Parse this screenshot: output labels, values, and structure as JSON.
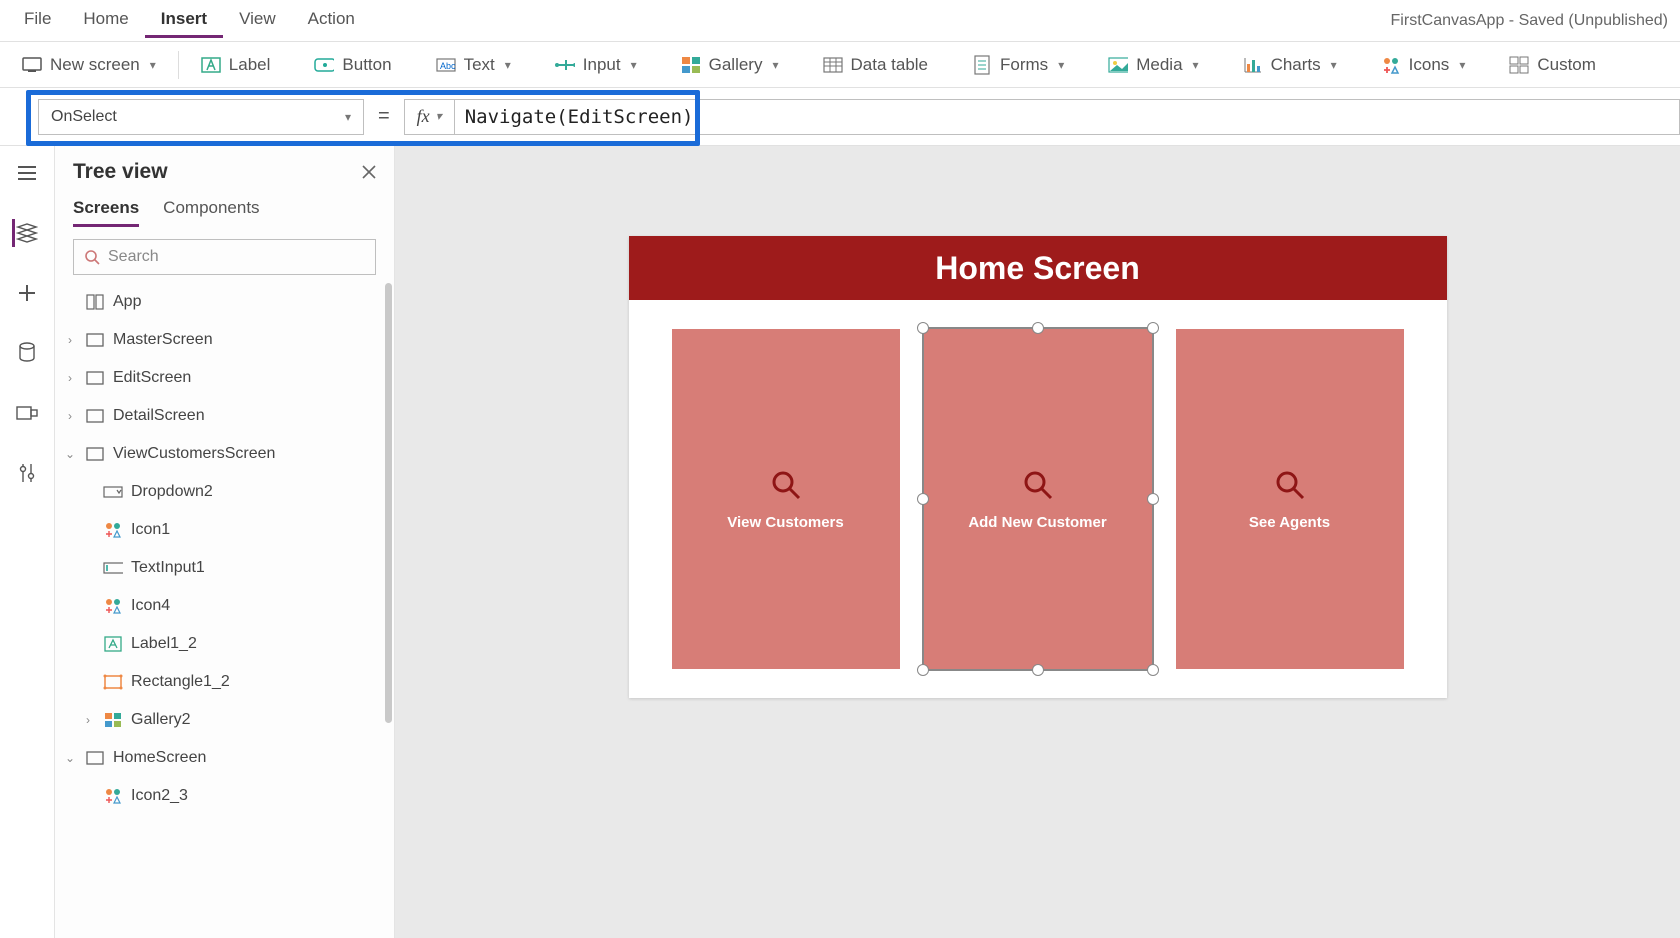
{
  "menubar": {
    "items": [
      {
        "label": "File"
      },
      {
        "label": "Home"
      },
      {
        "label": "Insert",
        "active": true
      },
      {
        "label": "View"
      },
      {
        "label": "Action"
      }
    ],
    "app_title": "FirstCanvasApp - Saved (Unpublished)"
  },
  "ribbon": {
    "new_screen": "New screen",
    "label": "Label",
    "button": "Button",
    "text": "Text",
    "input": "Input",
    "gallery": "Gallery",
    "data_table": "Data table",
    "forms": "Forms",
    "media": "Media",
    "charts": "Charts",
    "icons": "Icons",
    "custom": "Custom"
  },
  "formula": {
    "property": "OnSelect",
    "equals": "=",
    "fx": "fx",
    "value": "Navigate(EditScreen)"
  },
  "tree": {
    "title": "Tree view",
    "tabs": {
      "screens": "Screens",
      "components": "Components"
    },
    "search_placeholder": "Search",
    "nodes": [
      {
        "label": "App",
        "icon": "app",
        "indent": 1
      },
      {
        "label": "MasterScreen",
        "icon": "screen",
        "indent": 1,
        "caret": "right"
      },
      {
        "label": "EditScreen",
        "icon": "screen",
        "indent": 1,
        "caret": "right"
      },
      {
        "label": "DetailScreen",
        "icon": "screen",
        "indent": 1,
        "caret": "right"
      },
      {
        "label": "ViewCustomersScreen",
        "icon": "screen",
        "indent": 1,
        "caret": "down"
      },
      {
        "label": "Dropdown2",
        "icon": "dropdown",
        "indent": 2
      },
      {
        "label": "Icon1",
        "icon": "icon",
        "indent": 2
      },
      {
        "label": "TextInput1",
        "icon": "textinput",
        "indent": 2
      },
      {
        "label": "Icon4",
        "icon": "icon",
        "indent": 2
      },
      {
        "label": "Label1_2",
        "icon": "label",
        "indent": 2
      },
      {
        "label": "Rectangle1_2",
        "icon": "rect",
        "indent": 2
      },
      {
        "label": "Gallery2",
        "icon": "gallery",
        "indent": 2,
        "caret": "right"
      },
      {
        "label": "HomeScreen",
        "icon": "screen",
        "indent": 1,
        "caret": "down"
      },
      {
        "label": "Icon2_3",
        "icon": "icon",
        "indent": 2
      }
    ]
  },
  "canvas": {
    "header": "Home Screen",
    "cards": [
      {
        "label": "View Customers",
        "selected": false
      },
      {
        "label": "Add New Customer",
        "selected": true
      },
      {
        "label": "See Agents",
        "selected": false
      }
    ]
  }
}
